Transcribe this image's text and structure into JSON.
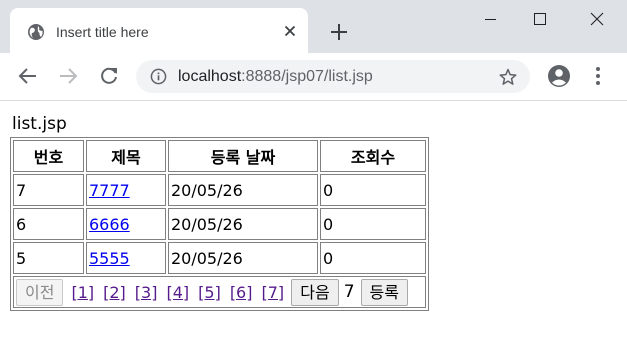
{
  "browser": {
    "tab_title": "Insert title here",
    "url_host": "localhost",
    "url_path": ":8888/jsp07/list.jsp",
    "icons": {
      "favicon": "globe-icon",
      "close": "close-icon",
      "new_tab": "plus-icon",
      "back": "arrow-left-icon",
      "forward": "arrow-right-icon",
      "reload": "reload-icon",
      "site_info": "info-icon",
      "bookmark": "star-icon",
      "profile": "account-icon",
      "menu": "kebab-menu-icon"
    }
  },
  "page": {
    "heading": "list.jsp"
  },
  "table": {
    "headers": [
      "번호",
      "제목",
      "등록 날짜",
      "조회수"
    ],
    "rows": [
      {
        "no": "7",
        "title": "7777",
        "date": "20/05/26",
        "views": "0"
      },
      {
        "no": "6",
        "title": "6666",
        "date": "20/05/26",
        "views": "0"
      },
      {
        "no": "5",
        "title": "5555",
        "date": "20/05/26",
        "views": "0"
      }
    ]
  },
  "pagination": {
    "prev_label": "이전",
    "prev_disabled": true,
    "pages": [
      "[1]",
      "[2]",
      "[3]",
      "[4]",
      "[5]",
      "[6]",
      "[7]"
    ],
    "next_label": "다음",
    "current_page": "7",
    "register_label": "등록"
  }
}
